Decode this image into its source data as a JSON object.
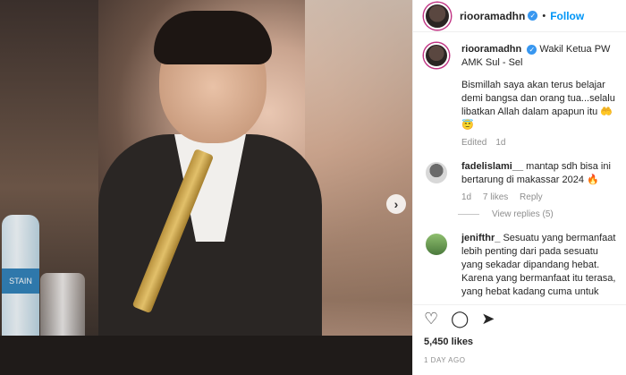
{
  "post": {
    "image": {
      "bottle_label": "STAIN",
      "next_icon": "chevron-right-icon"
    }
  },
  "header": {
    "username": "riooramadhn",
    "follow_label": "Follow",
    "verified_icon": "verified-badge-icon"
  },
  "caption": {
    "username": "riooramadhn",
    "line1": "Wakil Ketua PW AMK Sul - Sel",
    "line2": "Bismillah saya akan terus belajar demi bangsa dan orang tua...selalu libatkan Allah dalam apapun itu",
    "emoji": "🤲😇",
    "edited": "Edited",
    "age": "1d"
  },
  "comments": [
    {
      "username": "fadelislami__",
      "text": "mantap sdh bisa ini bertarung di makassar 2024 🔥",
      "age": "1d",
      "likes": "7 likes",
      "reply": "Reply",
      "view_replies": "View replies (5)"
    },
    {
      "username": "jenifthr_",
      "text": "Sesuatu yang bermanfaat lebih penting dari pada sesuatu yang sekadar dipandang hebat. Karena yang bermanfaat itu terasa, yang hebat kadang cuma untuk"
    }
  ],
  "actions": {
    "like_icon": "heart-icon",
    "comment_icon": "comment-icon",
    "share_icon": "share-icon"
  },
  "likes": "5,450 likes",
  "date": "1 DAY AGO"
}
